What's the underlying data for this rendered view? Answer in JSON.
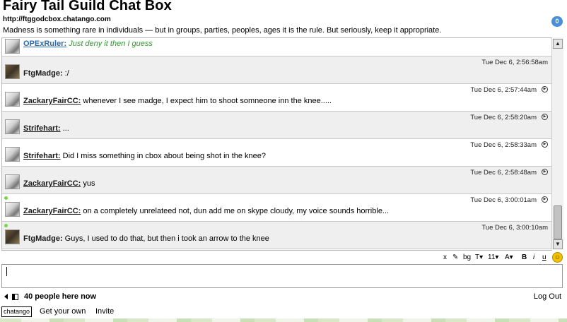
{
  "header": {
    "title": "Fairy Tail Guild Chat Box",
    "url": "http://ftggodcbox.chatango.com",
    "description": "Madness is something rare in individuals — but in groups, parties, peoples, ages it is the rule. But seriously, keep it appropriate.",
    "badge_count": "0"
  },
  "messages": [
    {
      "user": "OPExRuler:",
      "text": "Just deny it then I guess",
      "time": ""
    },
    {
      "user": "FtgMadge:",
      "text": ":/",
      "time": "Tue Dec 6, 2:56:58am"
    },
    {
      "user": "ZackaryFairCC:",
      "text": "whenever I see madge, I expect him to shoot somneone inn the knee.....",
      "time": "Tue Dec 6, 2:57:44am"
    },
    {
      "user": "Strifehart:",
      "text": "...",
      "time": "Tue Dec 6, 2:58:20am"
    },
    {
      "user": "Strifehart:",
      "text": "Did I miss something in cbox about being shot in the knee?",
      "time": "Tue Dec 6, 2:58:33am"
    },
    {
      "user": "ZackaryFairCC:",
      "text": "yus",
      "time": "Tue Dec 6, 2:58:48am"
    },
    {
      "user": "ZackaryFairCC:",
      "text": "on a completely unrelateed not, dun add me on skype cloudy, my voice sounds horrible...",
      "time": "Tue Dec 6, 3:00:01am"
    },
    {
      "user": "FtgMadge:",
      "text": "Guys, I used to do that, but then i took an arrow to the knee",
      "time": "Tue Dec 6, 3:00:10am"
    }
  ],
  "toolbar": {
    "close": "x",
    "bg": "bg",
    "text_style": "T",
    "font_size": "11",
    "bold": "B",
    "italic": "i",
    "underline": "u"
  },
  "footer": {
    "people": "40 people here now",
    "logout": "Log Out",
    "logo": "chatango",
    "get_your_own": "Get your own",
    "invite": "Invite"
  },
  "colors": {
    "link": "#2a6ab0",
    "quote_text": "#2a9a2a",
    "badge": "#4a8fd8",
    "online_dot": "#7cd34a"
  }
}
